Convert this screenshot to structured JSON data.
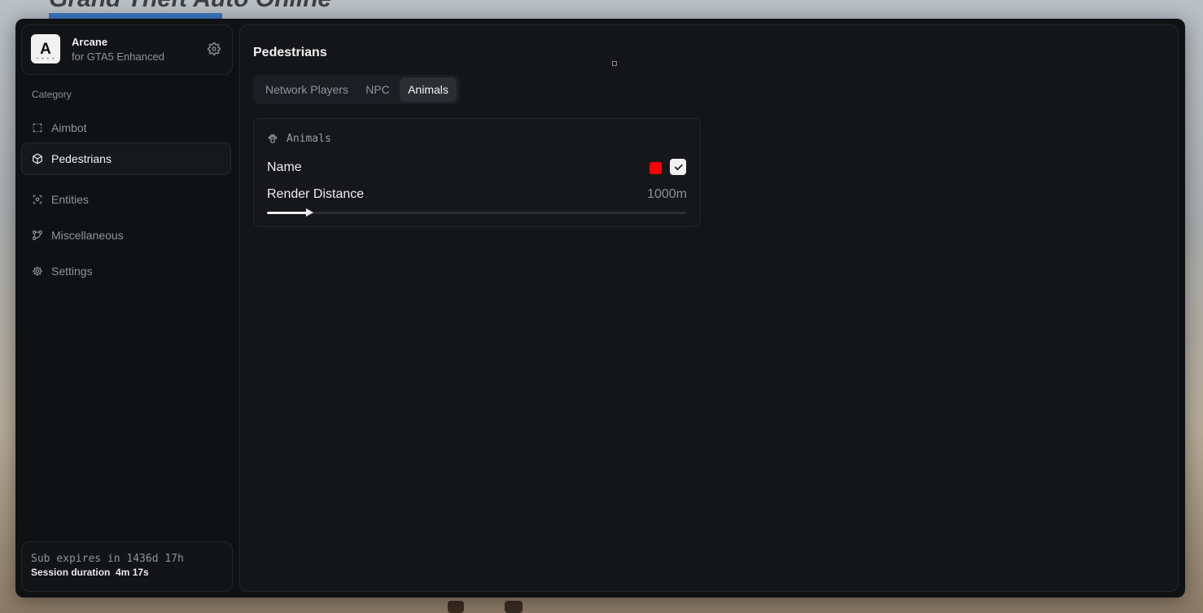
{
  "background": {
    "title": "Grand Theft Auto Online"
  },
  "brand": {
    "name": "Arcane",
    "subtitle": "for GTA5 Enhanced",
    "logo_letter": "A",
    "logo_dots": "● ● ● ●"
  },
  "sidebar": {
    "category_label": "Category",
    "items": [
      {
        "label": "Aimbot",
        "icon": "crosshair-dashed-icon",
        "active": false
      },
      {
        "label": "Pedestrians",
        "icon": "cube-icon",
        "active": true
      },
      {
        "label": "Entities",
        "icon": "scan-icon",
        "active": false
      },
      {
        "label": "Miscellaneous",
        "icon": "nodes-icon",
        "active": false
      },
      {
        "label": "Settings",
        "icon": "gear-icon",
        "active": false
      }
    ]
  },
  "footer": {
    "sub_expires": "Sub expires in 1436d 17h",
    "session_label": "Session duration",
    "session_value": "4m 17s"
  },
  "main": {
    "title": "Pedestrians",
    "tabs": [
      {
        "label": "Network Players",
        "active": false
      },
      {
        "label": "NPC",
        "active": false
      },
      {
        "label": "Animals",
        "active": true
      }
    ],
    "card": {
      "title": "Animals",
      "name_label": "Name",
      "name_color": "#ff0000",
      "name_enabled": true,
      "render_label": "Render Distance",
      "render_value": "1000m",
      "render_fraction": 0.1
    }
  },
  "colors": {
    "accent": "#f1f1f1",
    "background": "#0f1113",
    "name_color": "#ff0000"
  }
}
